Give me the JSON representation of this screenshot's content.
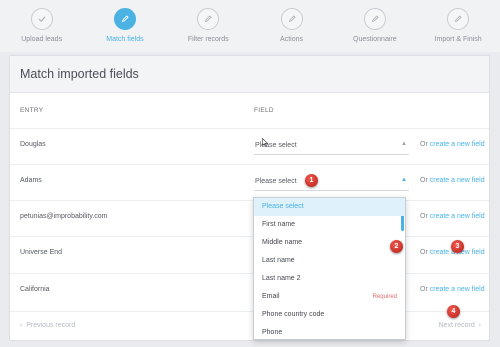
{
  "steps": [
    {
      "label": "Upload leads",
      "icon": "check-icon",
      "active": false
    },
    {
      "label": "Match fields",
      "icon": "pencil-icon",
      "active": true
    },
    {
      "label": "Filter records",
      "icon": "pencil-icon",
      "active": false
    },
    {
      "label": "Actions",
      "icon": "pencil-icon",
      "active": false
    },
    {
      "label": "Questionnaire",
      "icon": "pencil-icon",
      "active": false
    },
    {
      "label": "Import & Finish",
      "icon": "pencil-icon",
      "active": false
    }
  ],
  "panel": {
    "title": "Match imported fields",
    "col_entry": "ENTRY",
    "col_field": "FIELD"
  },
  "rows": [
    {
      "entry": "Douglas",
      "select": "Please select",
      "or": "Or",
      "link": "create a new field"
    },
    {
      "entry": "Adams",
      "select": "Please select",
      "or": "Or",
      "link": "create a new field"
    },
    {
      "entry": "petunias@improbability.com",
      "select": "",
      "or": "Or",
      "link": "create a new field"
    },
    {
      "entry": "Universe End",
      "select": "",
      "or": "Or",
      "link": "create a new field"
    },
    {
      "entry": "California",
      "select": "",
      "or": "Or",
      "link": "create a new field"
    }
  ],
  "footer": {
    "prev": "Previous record",
    "next": "Next record"
  },
  "dropdown": {
    "items": [
      "Please select",
      "First name",
      "Middle name",
      "Last name",
      "Last name 2",
      "Email",
      "Phone country code",
      "Phone"
    ],
    "required_label": "Required",
    "required_index": 5,
    "highlighted_index": 0
  },
  "badges": [
    "1",
    "2",
    "3",
    "4"
  ],
  "colors": {
    "accent": "#4ab3e4",
    "badge": "#d9302a",
    "required": "#e26a6a"
  }
}
